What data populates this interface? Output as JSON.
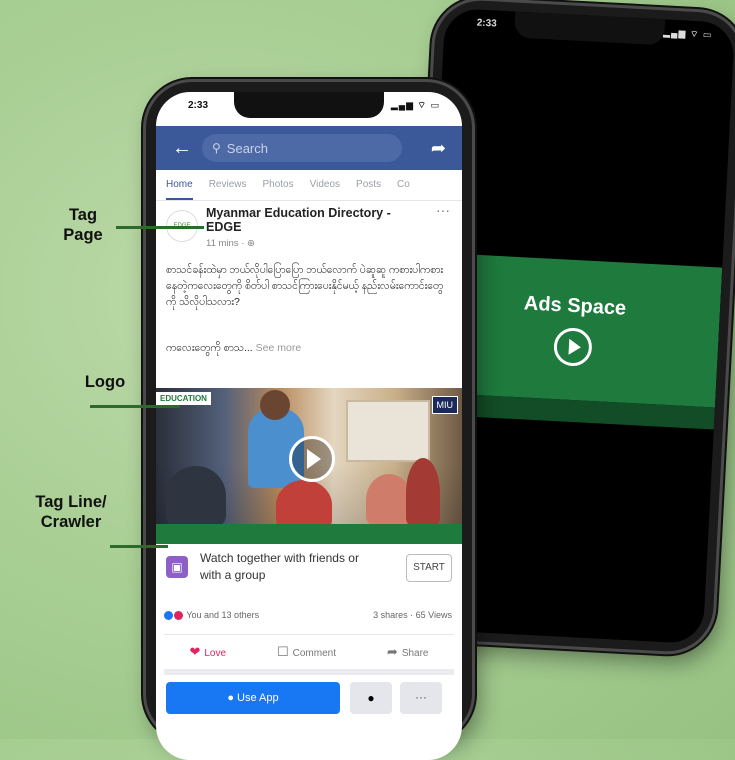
{
  "phone_back": {
    "status_time": "2:33",
    "status_icons": "▂▄▆ ⌔ ▭",
    "ads_label": "Ads Space"
  },
  "phone_front": {
    "status_time": "2:33",
    "status_icons": "▂▄▆ ⌔ ▭",
    "header": {
      "back_icon": "←",
      "search_placeholder": "Search",
      "share_icon": "➦"
    },
    "tabs": [
      "Home",
      "Reviews",
      "Photos",
      "Videos",
      "Posts",
      "Co"
    ],
    "post": {
      "page_name": "Myanmar Education Directory -EDGE",
      "meta": "11 mins · ⊕",
      "avatar_text": "EDGE",
      "text": "စာသင်ခန်းထဲမှာ ဘယ်လိုပါပြောပြော ဘယ်လောက် ပဲဆူဆူ ကစားပါကစားနေတဲ့ကလေးတွေကို စိတ်ပါ စာသင်ကြားပေးနိုင်မယ့် နည်းလမ်းကောင်းတွေကို သိလိုပါသလား?",
      "subtext": "ကလေးတွေကို စာသ...",
      "see_more": "See more",
      "video_logo_left": "EDUCATION",
      "video_logo_right": "MIU"
    },
    "watch": {
      "text": "Watch together with friends or with a group",
      "button": "START"
    },
    "reactions": {
      "left": "You and 13 others",
      "right": "3 shares · 65 Views"
    },
    "actions": {
      "love": "Love",
      "comment": "Comment",
      "share": "Share"
    },
    "bottom": {
      "use_app": "Use App",
      "messenger_icon": "●",
      "more": "···"
    }
  },
  "callouts": {
    "tag_page": "Tag\nPage",
    "logo": "Logo",
    "tag_line": "Tag Line/\nCrawler"
  },
  "colors": {
    "background": "#a9cf95",
    "facebook_blue": "#3b5998",
    "brand_green": "#1f7a3e",
    "use_app_blue": "#1877f2"
  }
}
